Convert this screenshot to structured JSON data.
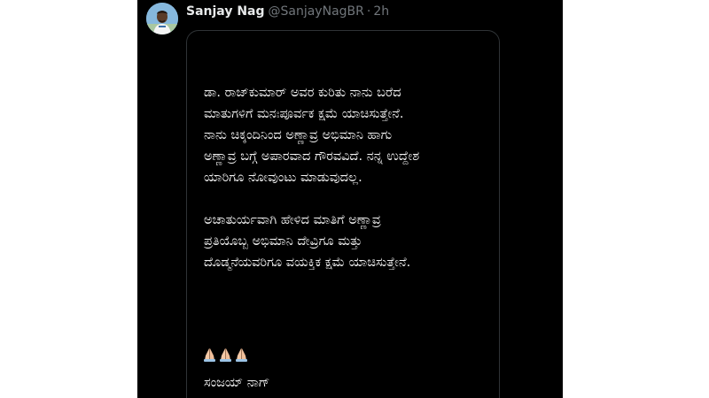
{
  "tweet": {
    "author": {
      "display_name": "Sanjay Nag",
      "handle": "@SanjayNagBR",
      "separator": "·",
      "timestamp": "2h"
    },
    "media": {
      "paragraph_1": [
        "ಡಾ. ರಾಜ್‌ಕುಮಾರ್ ಅವರ ಕುರಿತು ನಾನು ಬರೆದ",
        "ಮಾತುಗಳಿಗೆ ಮನಃಪೂರ್ವಕ ಕ್ಷಮೆ ಯಾಚಿಸುತ್ತೇನೆ.",
        "ನಾನು ಚಿಕ್ಕಂದಿನಿಂದ ಅಣ್ಣಾವ್ರ ಅಭಿಮಾನಿ ಹಾಗು",
        "ಅಣ್ಣಾವ್ರ ಬಗ್ಗೆ ಅಪಾರವಾದ ಗೌರವವಿದೆ.  ನನ್ನ ಉದ್ದೇಶ",
        "ಯಾರಿಗೂ ನೋವುಂಟು ಮಾಡುವುದಲ್ಲ."
      ],
      "paragraph_2": [
        "ಅಚಾತುರ್ಯವಾಗಿ ಹೇಳಿದ ಮಾತಿಗೆ ಅಣ್ಣಾವ್ರ",
        "ಪ್ರತಿಯೊಬ್ಬ ಅಭಿಮಾನಿ ದೇವ್ರಿಗೂ ಮತ್ತು",
        "ದೊಡ್ಮನೆಯವರಿಗೂ ವಯಕ್ತಿಕ ಕ್ಷಮೆ ಯಾಚಿಸುತ್ತೇನೆ."
      ],
      "emoji": [
        "folded-hands",
        "folded-hands",
        "folded-hands"
      ],
      "signature": "ಸಂಜಯ್ ನಾಗ್"
    }
  },
  "colors": {
    "page_background": "#ffffff",
    "tweet_background": "#000000",
    "primary_text": "#e7e9ea",
    "secondary_text": "#71767b",
    "card_border": "#2f3336"
  }
}
